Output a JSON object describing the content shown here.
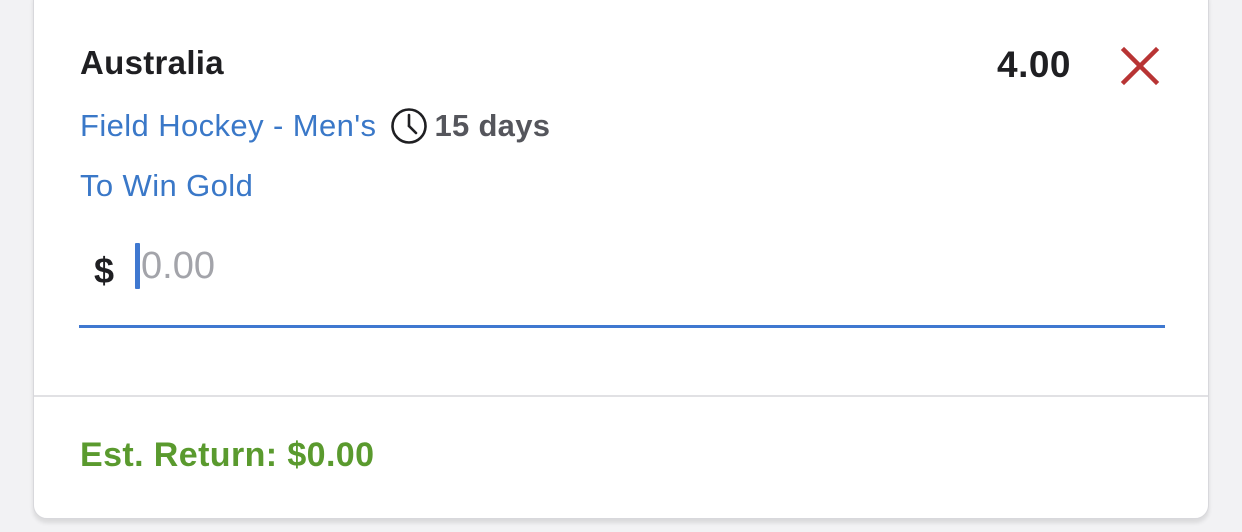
{
  "bet": {
    "selection": "Australia",
    "odds": "4.00",
    "event": "Field Hockey - Men's",
    "time_remaining": "15 days",
    "market": "To Win Gold"
  },
  "stake": {
    "currency_symbol": "$",
    "value": "",
    "placeholder": "0.00"
  },
  "footer": {
    "est_return": "Est. Return: $0.00"
  },
  "icons": {
    "remove": "close-icon",
    "time": "clock-icon"
  },
  "colors": {
    "link": "#3a78c8",
    "remove": "#b83434",
    "focus": "#3f78d0",
    "return": "#5a9a2e"
  }
}
